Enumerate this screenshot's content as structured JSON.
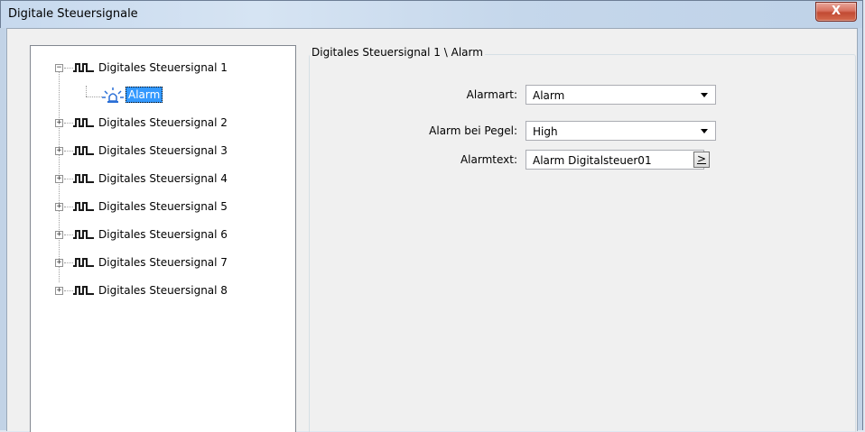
{
  "window": {
    "title": "Digitale Steuersignale",
    "close_label": "X"
  },
  "tree": {
    "nodes": [
      {
        "label": "Digitales Steuersignal 1",
        "expanded": true,
        "icon": "pulse-signal-icon"
      },
      {
        "label": "Digitales Steuersignal 2",
        "expanded": false,
        "icon": "pulse-signal-icon"
      },
      {
        "label": "Digitales Steuersignal 3",
        "expanded": false,
        "icon": "pulse-signal-icon"
      },
      {
        "label": "Digitales Steuersignal 4",
        "expanded": false,
        "icon": "pulse-signal-icon"
      },
      {
        "label": "Digitales Steuersignal 5",
        "expanded": false,
        "icon": "pulse-signal-icon"
      },
      {
        "label": "Digitales Steuersignal 6",
        "expanded": false,
        "icon": "pulse-signal-icon"
      },
      {
        "label": "Digitales Steuersignal 7",
        "expanded": false,
        "icon": "pulse-signal-icon"
      },
      {
        "label": "Digitales Steuersignal 8",
        "expanded": false,
        "icon": "pulse-signal-icon"
      }
    ],
    "child": {
      "label": "Alarm",
      "icon": "alarm-light-icon",
      "selected": true
    },
    "expand_glyph": "+",
    "collapse_glyph": "−"
  },
  "panel": {
    "title": "Digitales Steuersignal 1 \\ Alarm",
    "fields": {
      "alarmart": {
        "label": "Alarmart:",
        "value": "Alarm"
      },
      "pegel": {
        "label": "Alarm bei Pegel:",
        "value": "High"
      },
      "alarmtext": {
        "label": "Alarmtext:",
        "value": "Alarm Digitalsteuer01",
        "button_label": ">"
      }
    }
  },
  "colors": {
    "selection": "#3399ff",
    "close_button": "#c24a33",
    "alarm_icon": "#2a6fd6"
  }
}
